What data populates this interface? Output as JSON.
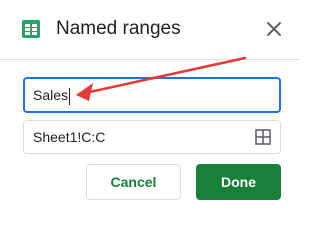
{
  "header": {
    "title": "Named ranges",
    "icon": "google-sheets-icon",
    "close_icon": "close-icon"
  },
  "form": {
    "name_value": "Sales",
    "range_value": "Sheet1!C:C",
    "range_picker_icon": "grid-select-icon"
  },
  "actions": {
    "cancel_label": "Cancel",
    "done_label": "Done"
  },
  "annotation": {
    "type": "arrow",
    "points_to": "name-input"
  },
  "colors": {
    "brand_green": "#188038",
    "sheets_icon_green": "#23a566",
    "focus_blue": "#1a73e8",
    "annotation_red": "#e53935",
    "border_gray": "#dadce0",
    "text_dark": "#202124"
  }
}
